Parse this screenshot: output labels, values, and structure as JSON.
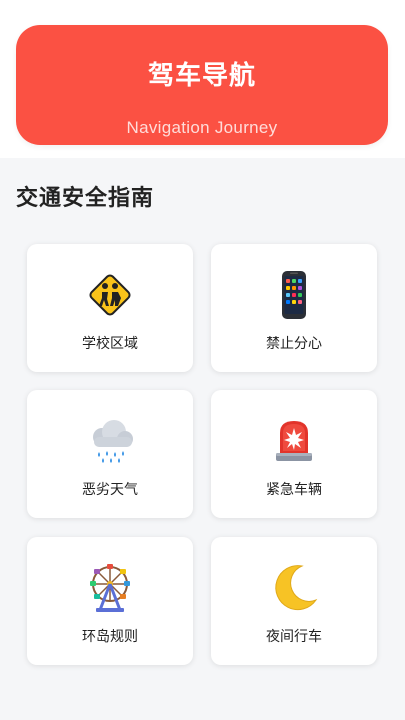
{
  "header": {
    "title": "驾车导航",
    "subtitle": "Navigation Journey",
    "bg_color": "#fb5143"
  },
  "section": {
    "title": "交通安全指南"
  },
  "cards": [
    {
      "label": "学校区域",
      "icon": "school-crossing-sign-icon"
    },
    {
      "label": "禁止分心",
      "icon": "mobile-phone-icon"
    },
    {
      "label": "恶劣天气",
      "icon": "rain-cloud-icon"
    },
    {
      "label": "紧急车辆",
      "icon": "emergency-siren-icon"
    },
    {
      "label": "环岛规则",
      "icon": "ferris-wheel-icon"
    },
    {
      "label": "夜间行车",
      "icon": "crescent-moon-icon"
    }
  ]
}
